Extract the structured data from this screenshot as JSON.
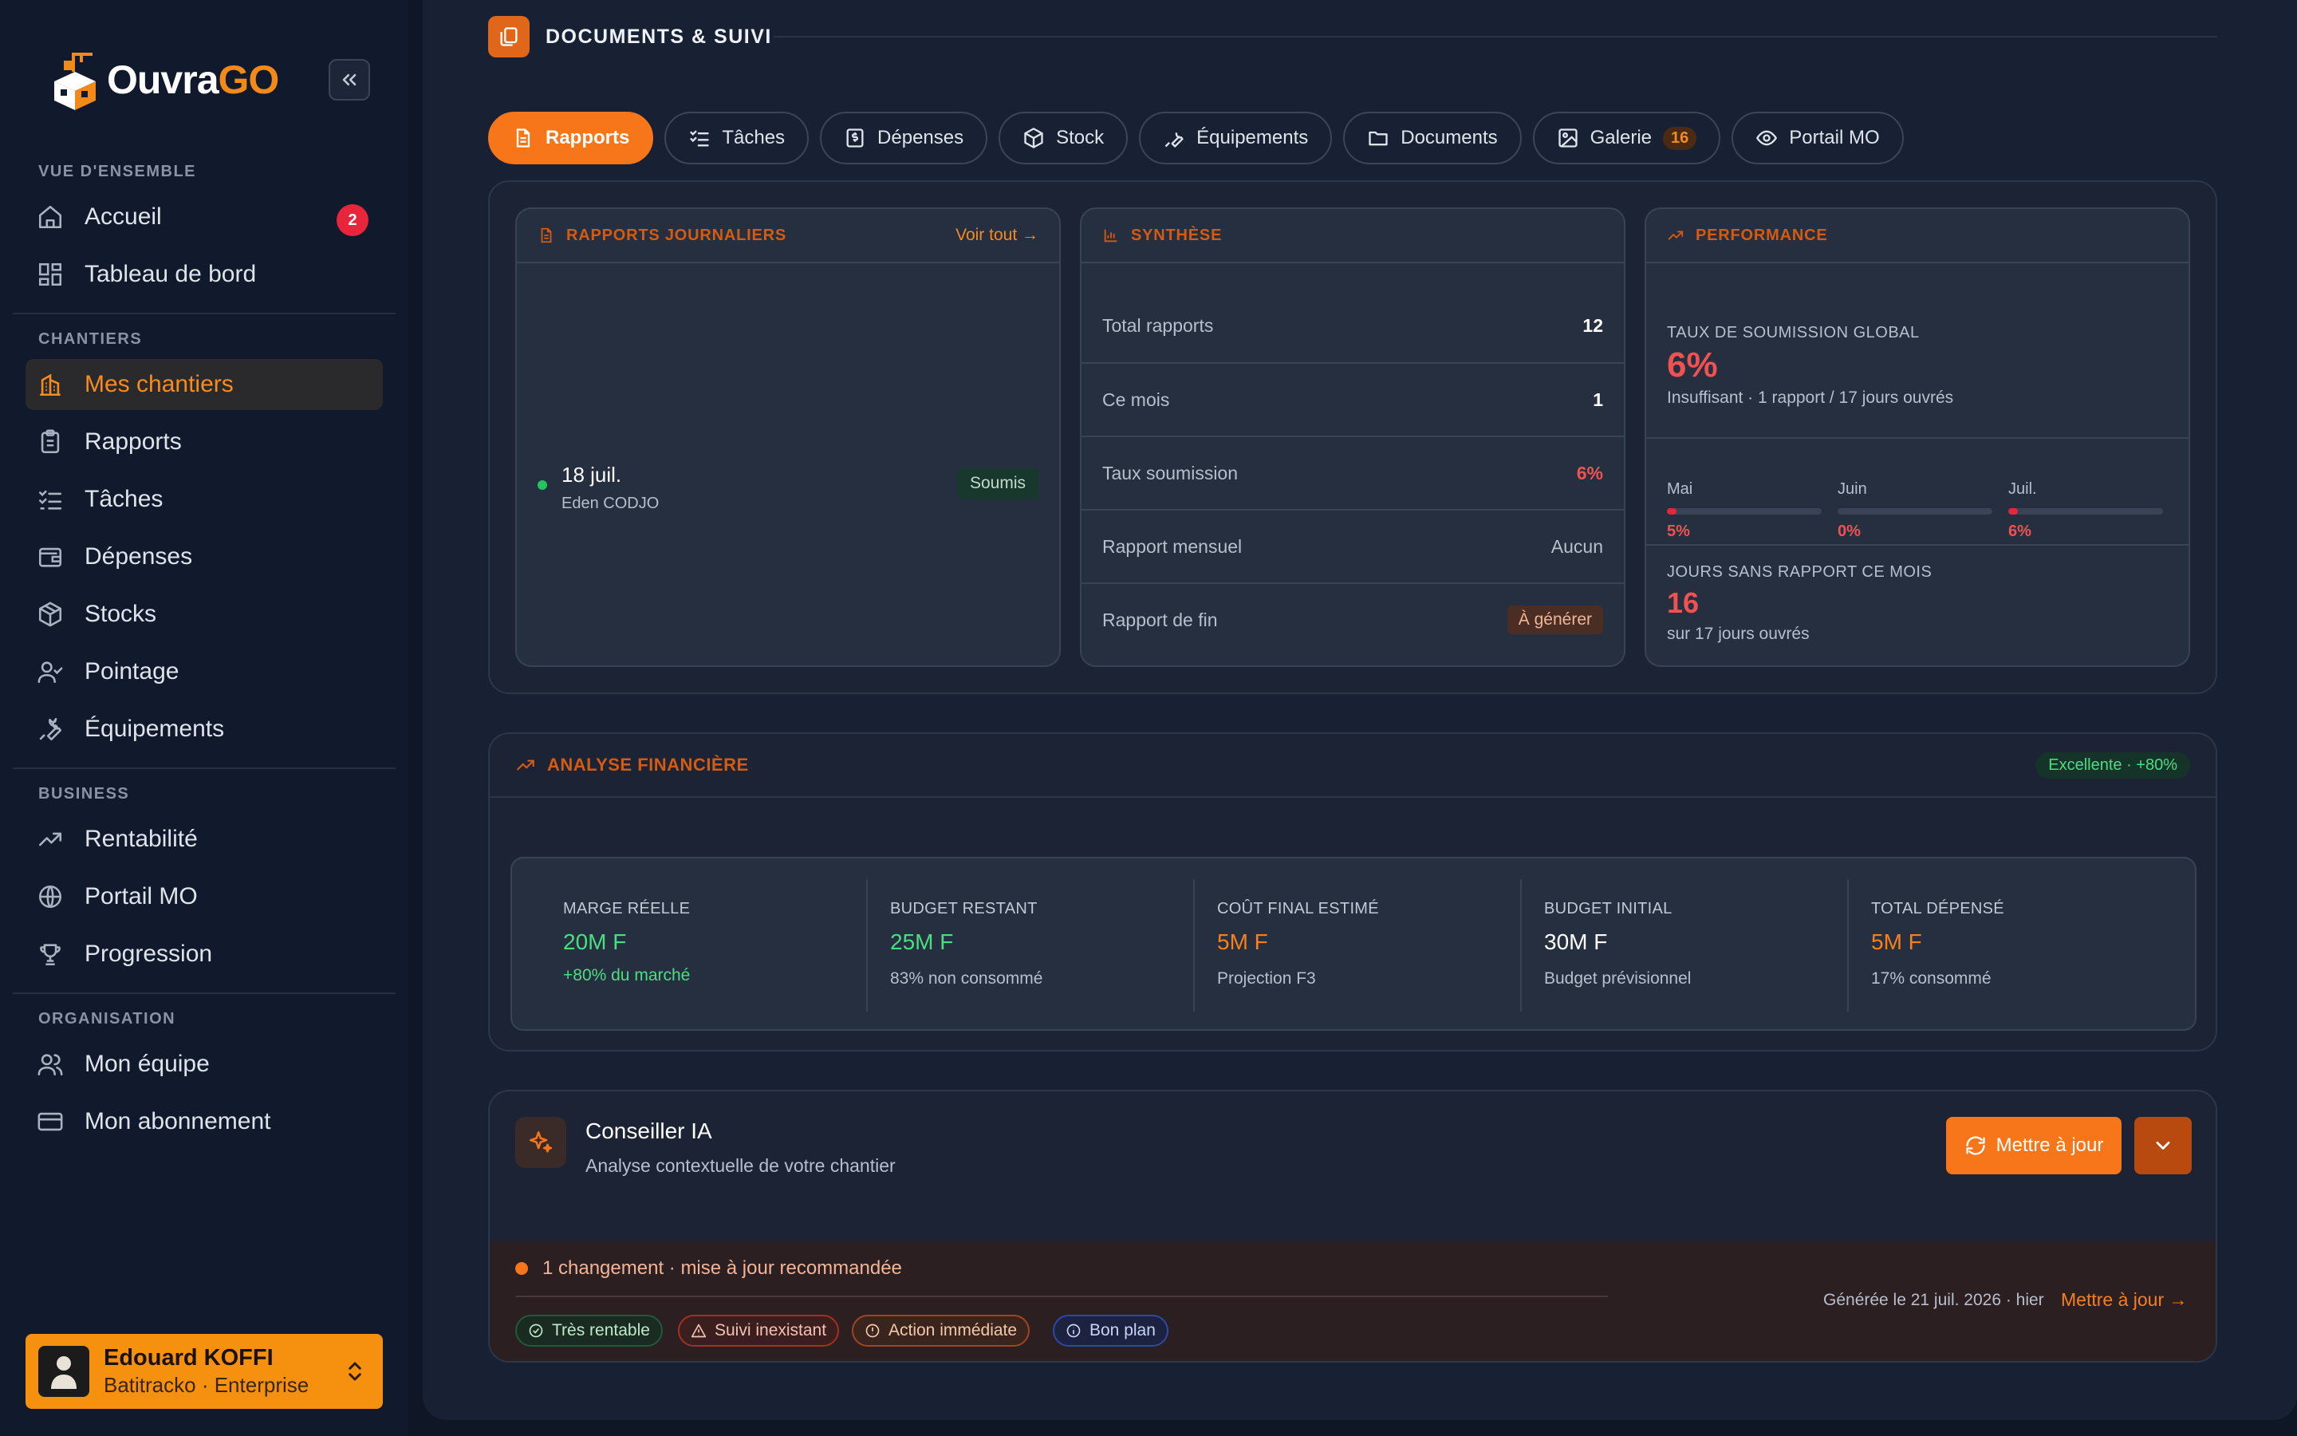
{
  "app": {
    "logo_main": "Ouvra",
    "logo_accent": "GO"
  },
  "sidebar": {
    "sections": [
      "VUE D'ENSEMBLE",
      "CHANTIERS",
      "BUSINESS",
      "ORGANISATION"
    ],
    "items": [
      {
        "label": "Accueil",
        "badge": "2"
      },
      {
        "label": "Tableau de bord"
      },
      {
        "label": "Mes chantiers"
      },
      {
        "label": "Rapports"
      },
      {
        "label": "Tâches"
      },
      {
        "label": "Dépenses"
      },
      {
        "label": "Stocks"
      },
      {
        "label": "Pointage"
      },
      {
        "label": "Équipements"
      },
      {
        "label": "Rentabilité"
      },
      {
        "label": "Portail MO"
      },
      {
        "label": "Progression"
      },
      {
        "label": "Mon équipe"
      },
      {
        "label": "Mon abonnement"
      }
    ],
    "user": {
      "name": "Edouard KOFFI",
      "org": "Batitracko · Enterprise"
    }
  },
  "section": {
    "title": "DOCUMENTS & SUIVI"
  },
  "tabs": [
    {
      "label": "Rapports"
    },
    {
      "label": "Tâches"
    },
    {
      "label": "Dépenses"
    },
    {
      "label": "Stock"
    },
    {
      "label": "Équipements"
    },
    {
      "label": "Documents"
    },
    {
      "label": "Galerie",
      "badge": "16"
    },
    {
      "label": "Portail MO"
    }
  ],
  "reports_card": {
    "title": "RAPPORTS JOURNALIERS",
    "see_all": "Voir tout →",
    "entry": {
      "date": "18 juil.",
      "author": "Eden CODJO",
      "status": "Soumis"
    }
  },
  "synthese": {
    "title": "SYNTHÈSE",
    "rows": [
      {
        "label": "Total rapports",
        "value": "12"
      },
      {
        "label": "Ce mois",
        "value": "1"
      },
      {
        "label": "Taux soumission",
        "value": "6%"
      },
      {
        "label": "Rapport mensuel",
        "value": "Aucun"
      },
      {
        "label": "Rapport de fin",
        "value": "À générer"
      }
    ]
  },
  "performance": {
    "title": "PERFORMANCE",
    "rate_label": "TAUX DE SOUMISSION GLOBAL",
    "rate_value": "6%",
    "rate_sub": "Insuffisant · 1 rapport / 17 jours ouvrés",
    "months": [
      {
        "name": "Mai",
        "value": "5%",
        "fraction": 0.05
      },
      {
        "name": "Juin",
        "value": "0%",
        "fraction": 0.0
      },
      {
        "name": "Juil.",
        "value": "6%",
        "fraction": 0.06
      }
    ],
    "days_label": "JOURS SANS RAPPORT CE MOIS",
    "days_value": "16",
    "days_sub": "sur 17 jours ouvrés"
  },
  "finance": {
    "title": "ANALYSE FINANCIÈRE",
    "badge": "Excellente · +80%",
    "metrics": [
      {
        "label": "MARGE RÉELLE",
        "value": "20M F",
        "sub": "+80% du marché"
      },
      {
        "label": "BUDGET RESTANT",
        "value": "25M F",
        "sub": "83% non consommé"
      },
      {
        "label": "COÛT FINAL ESTIMÉ",
        "value": "5M F",
        "sub": "Projection F3"
      },
      {
        "label": "BUDGET INITIAL",
        "value": "30M F",
        "sub": "Budget prévisionnel"
      },
      {
        "label": "TOTAL DÉPENSÉ",
        "value": "5M F",
        "sub": "17% consommé"
      }
    ]
  },
  "advisor": {
    "title": "Conseiller IA",
    "subtitle": "Analyse contextuelle de votre chantier",
    "update_button": "Mettre à jour",
    "change_text": "1 changement · mise à jour recommandée",
    "tags": [
      "Très rentable",
      "Suivi inexistant",
      "Action immédiate",
      "Bon plan"
    ],
    "generated": "Générée le 21 juil. 2026 · hier",
    "update_link": "Mettre à jour →"
  },
  "colors": {
    "accent": "#f7761a",
    "danger": "#f05252",
    "success": "#4ade80",
    "bg": "#0f1626"
  }
}
